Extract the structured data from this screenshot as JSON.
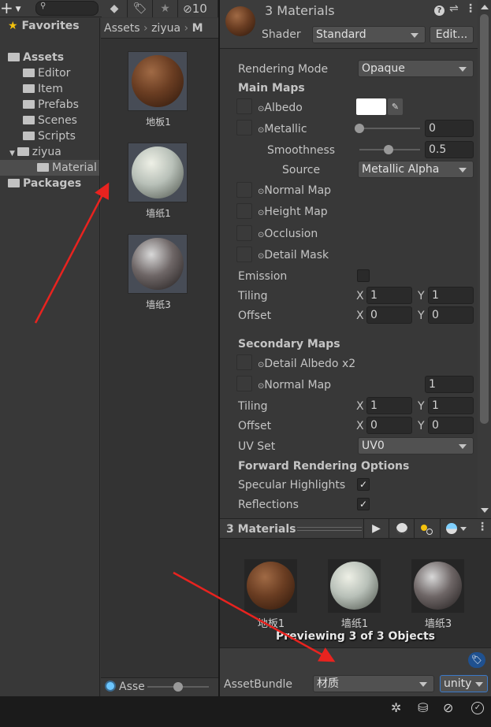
{
  "project": {
    "search_placeholder": "",
    "hidden_count": "10",
    "tree": [
      {
        "label": "Favorites"
      },
      {
        "label": "Assets"
      },
      {
        "label": "Editor"
      },
      {
        "label": "Item"
      },
      {
        "label": "Prefabs"
      },
      {
        "label": "Scenes"
      },
      {
        "label": "Scripts"
      },
      {
        "label": "ziyua"
      },
      {
        "label": "Material"
      },
      {
        "label": "Packages"
      }
    ],
    "breadcrumb": [
      "Assets",
      "ziyua",
      "M"
    ],
    "assets": [
      {
        "label": "地板1"
      },
      {
        "label": "墙纸1"
      },
      {
        "label": "墙纸3"
      }
    ],
    "bottom_label": "Asse",
    "icon_size_fraction": 0.5
  },
  "inspector": {
    "title": "3 Materials",
    "shader_label": "Shader",
    "shader_value": "Standard",
    "edit_label": "Edit...",
    "rendering_mode_label": "Rendering Mode",
    "rendering_mode_value": "Opaque",
    "main_maps": "Main Maps",
    "albedo": "Albedo",
    "albedo_color": "#ffffff",
    "metallic": "Metallic",
    "metallic_value": "0",
    "smoothness": "Smoothness",
    "smoothness_value": "0.5",
    "source": "Source",
    "source_value": "Metallic Alpha",
    "normal_map": "Normal Map",
    "height_map": "Height Map",
    "occlusion": "Occlusion",
    "detail_mask": "Detail Mask",
    "emission": "Emission",
    "tiling": "Tiling",
    "offset": "Offset",
    "x": "X",
    "y": "Y",
    "main_tiling": [
      "1",
      "1"
    ],
    "main_offset": [
      "0",
      "0"
    ],
    "secondary_maps": "Secondary Maps",
    "detail_albedo": "Detail Albedo x2",
    "detail_normal": "Normal Map",
    "detail_normal_value": "1",
    "sec_tiling": [
      "1",
      "1"
    ],
    "sec_offset": [
      "0",
      "0"
    ],
    "uv_set": "UV Set",
    "uv_set_value": "UV0",
    "forward": "Forward Rendering Options",
    "specular": "Specular Highlights",
    "reflections": "Reflections",
    "check": "✓"
  },
  "preview": {
    "title": "3 Materials",
    "items": [
      {
        "label": "地板1"
      },
      {
        "label": "墙纸1"
      },
      {
        "label": "墙纸3"
      }
    ],
    "caption": "Previewing 3 of 3 Objects"
  },
  "assetbundle": {
    "label": "AssetBundle",
    "value": "材质",
    "variant": "unity"
  },
  "annotation_color": "#e8231f"
}
